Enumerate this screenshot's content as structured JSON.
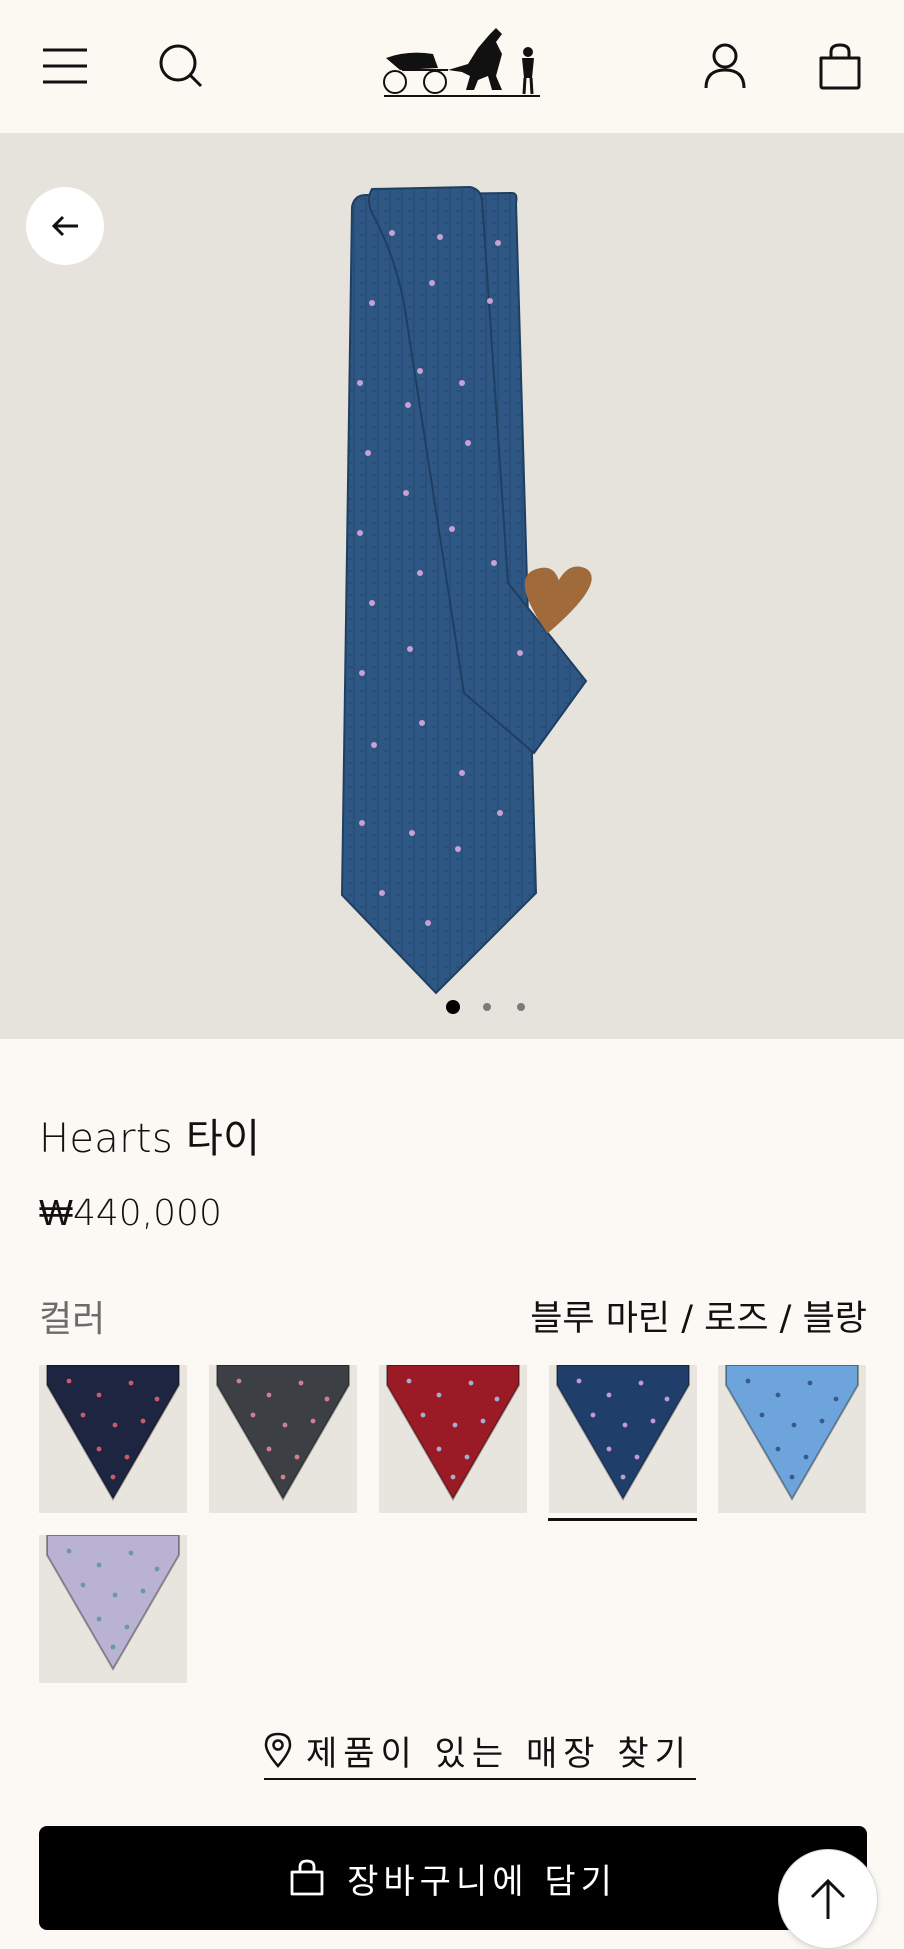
{
  "header": {
    "menu_icon": "hamburger-icon",
    "search_icon": "search-icon",
    "logo_icon": "carriage-logo",
    "account_icon": "user-icon",
    "bag_icon": "shopping-bag-icon"
  },
  "gallery": {
    "back_icon": "arrow-left-icon",
    "slide_count": 3,
    "active_slide": 1,
    "tie_color": "#2f5784",
    "heart_color": "#c49ad0"
  },
  "product": {
    "title": "Hearts 타이",
    "price": "₩440,000",
    "color_label": "컬러",
    "color_value": "블루 마린 / 로즈 / 블랑",
    "swatches": [
      {
        "color": "#1e2540",
        "dots": "#c85a6a",
        "selected": false
      },
      {
        "color": "#3c4045",
        "dots": "#d08090",
        "selected": false
      },
      {
        "color": "#9a1a25",
        "dots": "#9fb0d0",
        "selected": false
      },
      {
        "color": "#1f3f6a",
        "dots": "#c49ad0",
        "selected": true
      },
      {
        "color": "#6ea4dc",
        "dots": "#3a5a8a",
        "selected": false
      },
      {
        "color": "#b9b2d2",
        "dots": "#6a9aa0",
        "selected": false
      }
    ]
  },
  "actions": {
    "store_link": "제품이 있는 매장 찾기",
    "add_to_cart": "장바구니에 담기",
    "scroll_top_icon": "arrow-up-icon"
  }
}
